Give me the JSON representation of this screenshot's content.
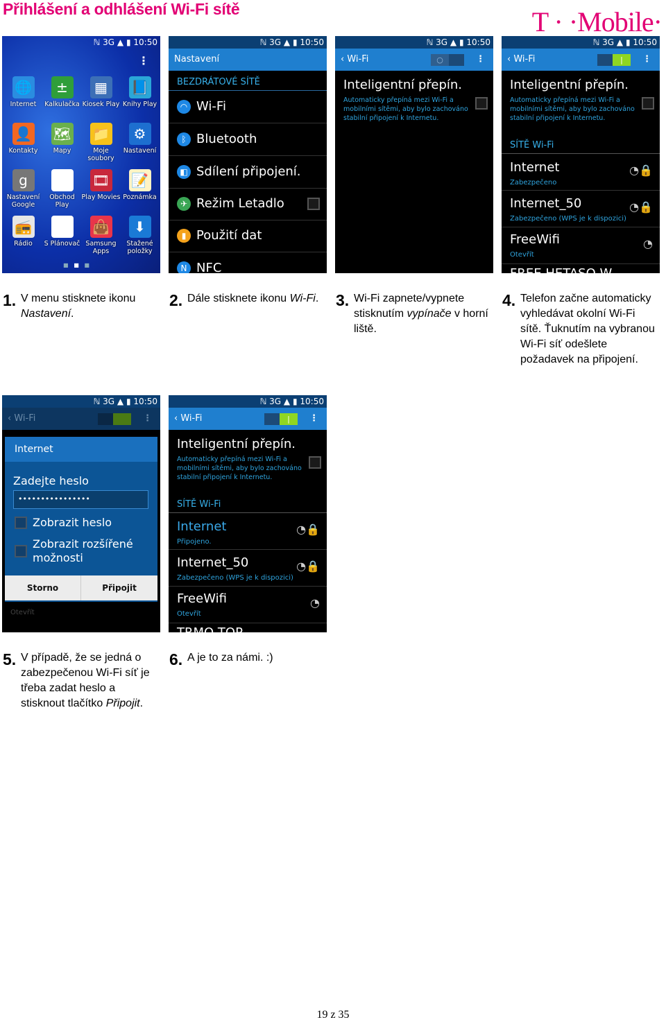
{
  "title": "Přihlášení a odhlášení Wi-Fi sítě",
  "logo": "T · ·Mobile·",
  "brand_color": "#e20074",
  "status_bar": {
    "icons": "ℕ 3G ▲ ▮",
    "time": "10:50"
  },
  "screen1": {
    "apps": [
      "Internet",
      "Kalkulačka",
      "Kiosek Play",
      "Knihy Play",
      "Kontakty",
      "Mapy",
      "Moje soubory",
      "Nastavení",
      "Nastavení Google",
      "Obchod Play",
      "Play Movies",
      "Poznámka",
      "Rádio",
      "S Plánovač",
      "Samsung Apps",
      "Stažené položky"
    ],
    "icons": [
      "🌐",
      "±",
      "▦",
      "📘",
      "👤",
      "🗺",
      "📁",
      "⚙",
      "g",
      "▶",
      "🎞",
      "📝",
      "📻",
      "31",
      "👜",
      "⬇"
    ],
    "icon_colors": [
      "#2a8de0",
      "#2f9e3a",
      "#3c6fb6",
      "#2aa6d8",
      "#f26722",
      "#6ab04c",
      "#f7c21b",
      "#1d6fd0",
      "#777777",
      "#ffffff",
      "#c8283c",
      "#fff3c4",
      "#e6e6e6",
      "#ffffff",
      "#e8354a",
      "#1a7ad6"
    ]
  },
  "screen2": {
    "header": "Nastavení",
    "section": "BEZDRÁTOVÉ SÍTĚ",
    "items": [
      "Wi-Fi",
      "Bluetooth",
      "Sdílení připojení.",
      "Režim Letadlo",
      "Použití dat",
      "NFC"
    ]
  },
  "wifi": {
    "header": "Wi-Fi",
    "smart_title": "Inteligentní přepín.",
    "smart_desc": "Automaticky přepíná mezi Wi-Fi a mobilními sítěmi, aby bylo zachováno stabilní připojení k Internetu.",
    "section": "SÍTĚ Wi-Fi",
    "networks": [
      {
        "name": "Internet",
        "status": "Zabezpečeno"
      },
      {
        "name": "Internet_50",
        "status": "Zabezpečeno (WPS je k dispozici)"
      },
      {
        "name": "FreeWifi",
        "status": "Otevřít"
      },
      {
        "name": "FREE HETASO W"
      }
    ],
    "networks6": [
      {
        "name": "Internet",
        "status": "Připojeno."
      },
      {
        "name": "Internet_50",
        "status": "Zabezpečeno (WPS je k dispozici)"
      },
      {
        "name": "FreeWifi",
        "status": "Otevřít"
      },
      {
        "name": "TRMO TOP"
      }
    ]
  },
  "dialog": {
    "title": "Internet",
    "label": "Zadejte heslo",
    "password": "••••••••••••••••",
    "show_password": "Zobrazit heslo",
    "advanced": "Zobrazit rozšířené možnosti",
    "cancel": "Storno",
    "connect": "Připojit"
  },
  "steps": [
    {
      "n": "1.",
      "text": "V menu stisknete ikonu ",
      "em": "Nastavení",
      "after": "."
    },
    {
      "n": "2.",
      "text": "Dále stisknete ikonu ",
      "em": "Wi-Fi",
      "after": "."
    },
    {
      "n": "3.",
      "text": "Wi-Fi zapnete/vypnete stisknutím ",
      "em": "vypínače",
      "after": " v horní liště."
    },
    {
      "n": "4.",
      "text": "Telefon začne automaticky vyhledávat okolní Wi-Fi sítě. Ťuknutím na vybranou Wi-Fi síť odešlete požadavek na připojení.",
      "em": "",
      "after": ""
    },
    {
      "n": "5.",
      "text": "V případě, že se jedná o zabezpečenou Wi-Fi síť je třeba zadat heslo a stisknout tlačítko ",
      "em": "Připojit",
      "after": "."
    },
    {
      "n": "6.",
      "text": "A je to za námi. :)",
      "em": "",
      "after": ""
    }
  ],
  "page": "19 z 35"
}
